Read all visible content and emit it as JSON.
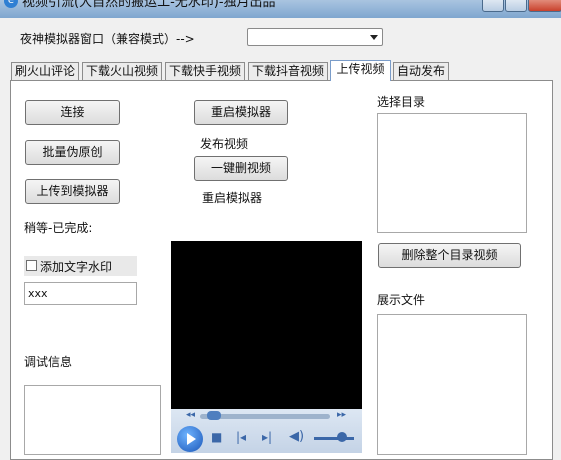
{
  "window": {
    "title": "视频引流(大自然的搬运工-无水印)-独月出品"
  },
  "emulator": {
    "label": "夜神模拟器窗口（兼容模式）-->",
    "selected": ""
  },
  "tabs": [
    {
      "label": "刷火山评论"
    },
    {
      "label": "下载火山视频"
    },
    {
      "label": "下载快手视频"
    },
    {
      "label": "下载抖音视频"
    },
    {
      "label": "上传视频"
    },
    {
      "label": "自动发布"
    }
  ],
  "buttons": {
    "connect": "连接",
    "batch_original": "批量伪原创",
    "upload_to_emulator": "上传到模拟器",
    "restart_emulator": "重启模拟器",
    "one_click_delete": "一键删视频",
    "delete_dir_videos": "删除整个目录视频"
  },
  "labels": {
    "status": "稍等-已完成:",
    "publish_video": "发布视频",
    "restart_emulator": "重启模拟器",
    "debug_info": "调试信息",
    "select_dir": "选择目录",
    "show_files": "展示文件"
  },
  "watermark": {
    "checkbox_label": "添加文字水印",
    "checked": false,
    "text_value": "xxx"
  },
  "player": {
    "progress": 0.05,
    "volume": 0.7
  }
}
